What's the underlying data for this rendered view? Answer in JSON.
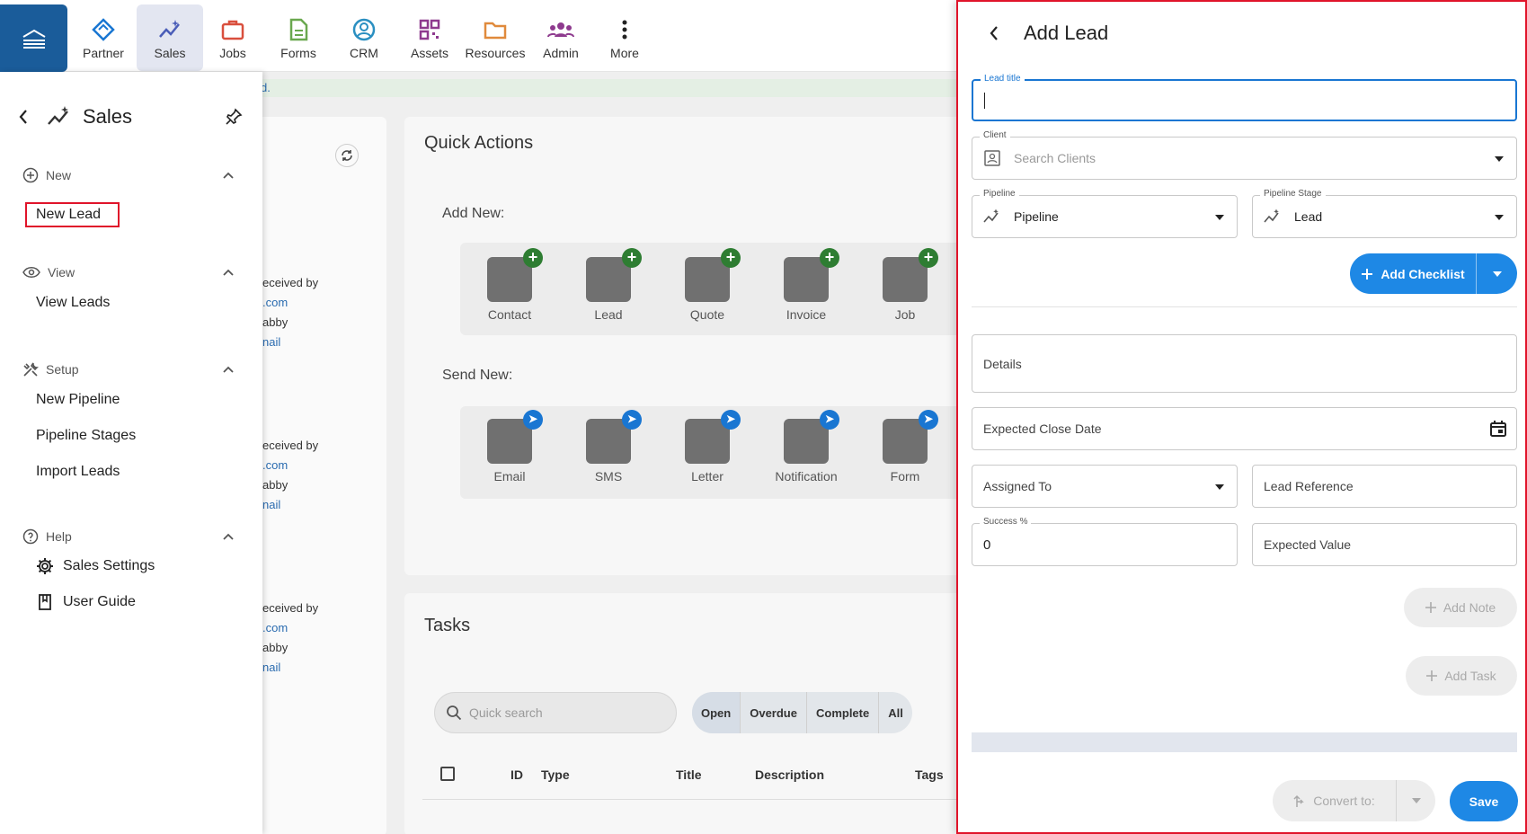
{
  "nav": {
    "items": [
      {
        "label": "Partner",
        "icon": "partner-icon"
      },
      {
        "label": "Sales",
        "icon": "sales-icon"
      },
      {
        "label": "Jobs",
        "icon": "briefcase-icon"
      },
      {
        "label": "Forms",
        "icon": "form-icon"
      },
      {
        "label": "CRM",
        "icon": "person-icon"
      },
      {
        "label": "Assets",
        "icon": "qr-icon"
      },
      {
        "label": "Resources",
        "icon": "folder-icon"
      },
      {
        "label": "Admin",
        "icon": "group-icon"
      },
      {
        "label": "More",
        "icon": "more-vertical-icon"
      }
    ]
  },
  "background": {
    "notice_tail": "d.",
    "recent_items": [
      {
        "l1": "eceived by",
        "l2": ".com",
        "l3": "abby",
        "l4": "nail"
      },
      {
        "l1": "eceived by",
        "l2": ".com",
        "l3": "abby",
        "l4": "nail"
      },
      {
        "l1": "eceived by",
        "l2": ".com",
        "l3": "abby",
        "l4": "nail"
      }
    ],
    "quick_actions": {
      "title": "Quick Actions",
      "add_new_label": "Add New:",
      "add_new": [
        "Contact",
        "Lead",
        "Quote",
        "Invoice",
        "Job"
      ],
      "send_new_label": "Send New:",
      "send_new": [
        "Email",
        "SMS",
        "Letter",
        "Notification",
        "Form"
      ]
    },
    "tasks": {
      "title": "Tasks",
      "search_placeholder": "Quick search",
      "filters": [
        "Open",
        "Overdue",
        "Complete",
        "All"
      ],
      "columns": [
        "ID",
        "Type",
        "Title",
        "Description",
        "Tags"
      ]
    }
  },
  "sidebar": {
    "title": "Sales",
    "sections": [
      {
        "label": "New",
        "icon": "plus-circle-icon"
      },
      {
        "label": "View",
        "icon": "eye-icon"
      },
      {
        "label": "Setup",
        "icon": "tools-icon"
      },
      {
        "label": "Help",
        "icon": "help-circle-icon"
      }
    ],
    "new_lead": "New Lead",
    "view_leads": "View Leads",
    "new_pipeline": "New Pipeline",
    "pipeline_stages": "Pipeline Stages",
    "import_leads": "Import Leads",
    "sales_settings": "Sales Settings",
    "user_guide": "User Guide"
  },
  "drawer": {
    "title": "Add Lead",
    "lead_title_label": "Lead title",
    "lead_title_value": "",
    "client_label": "Client",
    "client_placeholder": "Search Clients",
    "pipeline_label": "Pipeline",
    "pipeline_value": "Pipeline",
    "stage_label": "Pipeline Stage",
    "stage_value": "Lead",
    "add_checklist": "Add Checklist",
    "details_placeholder": "Details",
    "close_date_placeholder": "Expected Close Date",
    "assigned_to_placeholder": "Assigned To",
    "lead_reference_placeholder": "Lead Reference",
    "success_label": "Success %",
    "success_value": "0",
    "expected_value_placeholder": "Expected Value",
    "add_note": "Add Note",
    "add_task": "Add Task",
    "convert_to": "Convert to:",
    "save": "Save"
  },
  "colors": {
    "accent": "#1e88e5",
    "highlight_border": "#e0142a",
    "logo_bg": "#1a5c9a"
  }
}
